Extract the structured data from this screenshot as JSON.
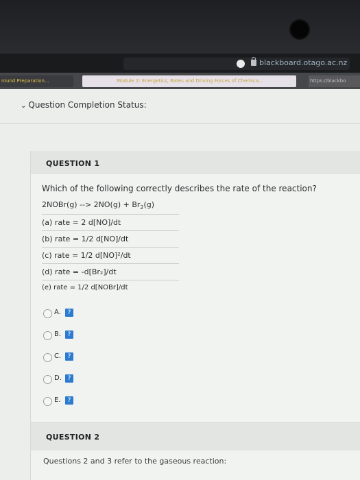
{
  "browser": {
    "url": "blackboard.otago.ac.nz",
    "tabs": [
      "round Preparation...",
      "Module 2: Energetics, Rates and Driving Forces of Chemica...",
      "https://blackbo"
    ]
  },
  "status": {
    "label": "Question Completion Status:"
  },
  "question1": {
    "title": "QUESTION 1",
    "prompt": "Which of the following correctly describes the rate of the reaction?",
    "reaction": "2NOBr(g) --> 2NO(g) + Br",
    "reaction_sub": "2",
    "reaction_end": "(g)",
    "choices": [
      "(a) rate = 2 d[NO]/dt",
      "(b) rate = 1/2 d[NO]/dt",
      "(c) rate = 1/2 d[NO]²/dt",
      "(d) rate = -d[Br₂]/dt",
      "(e) rate = 1/2 d[NOBr]/dt"
    ],
    "options": [
      "A.",
      "B.",
      "C.",
      "D.",
      "E."
    ],
    "help_glyph": "?"
  },
  "question2": {
    "title": "QUESTION 2",
    "text": "Questions 2 and 3 refer to the gaseous reaction:"
  }
}
